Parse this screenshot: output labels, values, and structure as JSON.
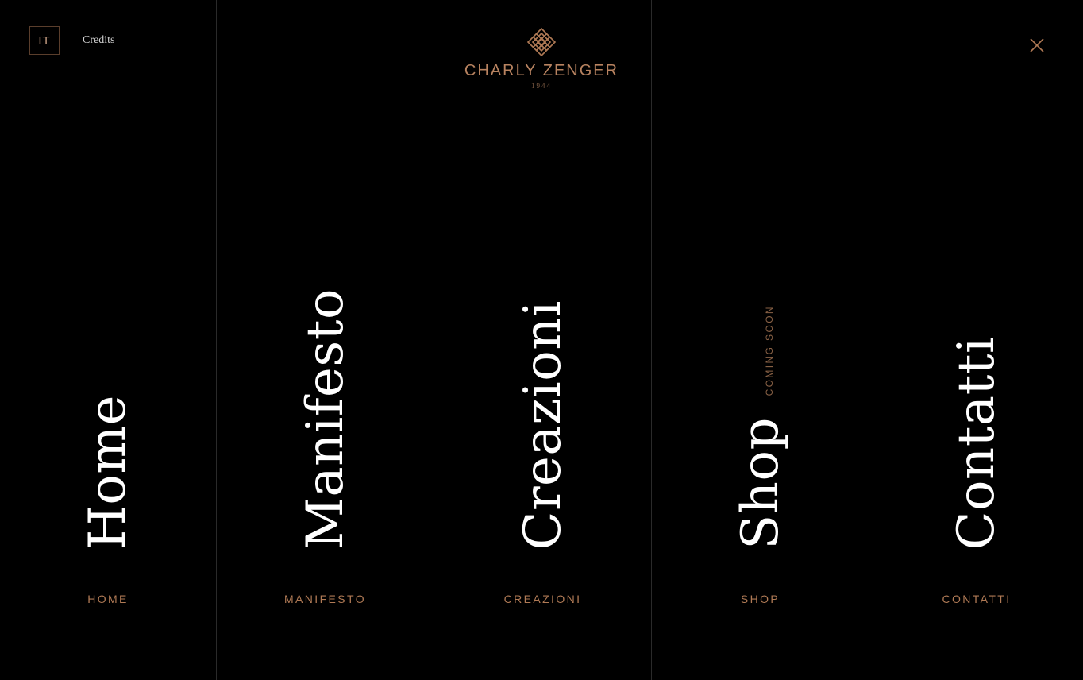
{
  "header": {
    "lang_label": "IT",
    "credits_label": "Credits",
    "logo": {
      "name": "CHARLY ZENGER",
      "year": "1944",
      "icon": "knot-emblem-icon"
    },
    "close_icon": "close-icon"
  },
  "menu": {
    "items": [
      {
        "title": "Home",
        "label": "HOME"
      },
      {
        "title": "Manifesto",
        "label": "MANIFESTO"
      },
      {
        "title": "Creazioni",
        "label": "CREAZIONI"
      },
      {
        "title": "Shop",
        "label": "SHOP",
        "note": "COMING SOON"
      },
      {
        "title": "Contatti",
        "label": "CONTATTI"
      }
    ]
  },
  "colors": {
    "background": "#000000",
    "accent": "#b07a55",
    "title": "#ffffff",
    "divider": "#2a2a2a"
  }
}
